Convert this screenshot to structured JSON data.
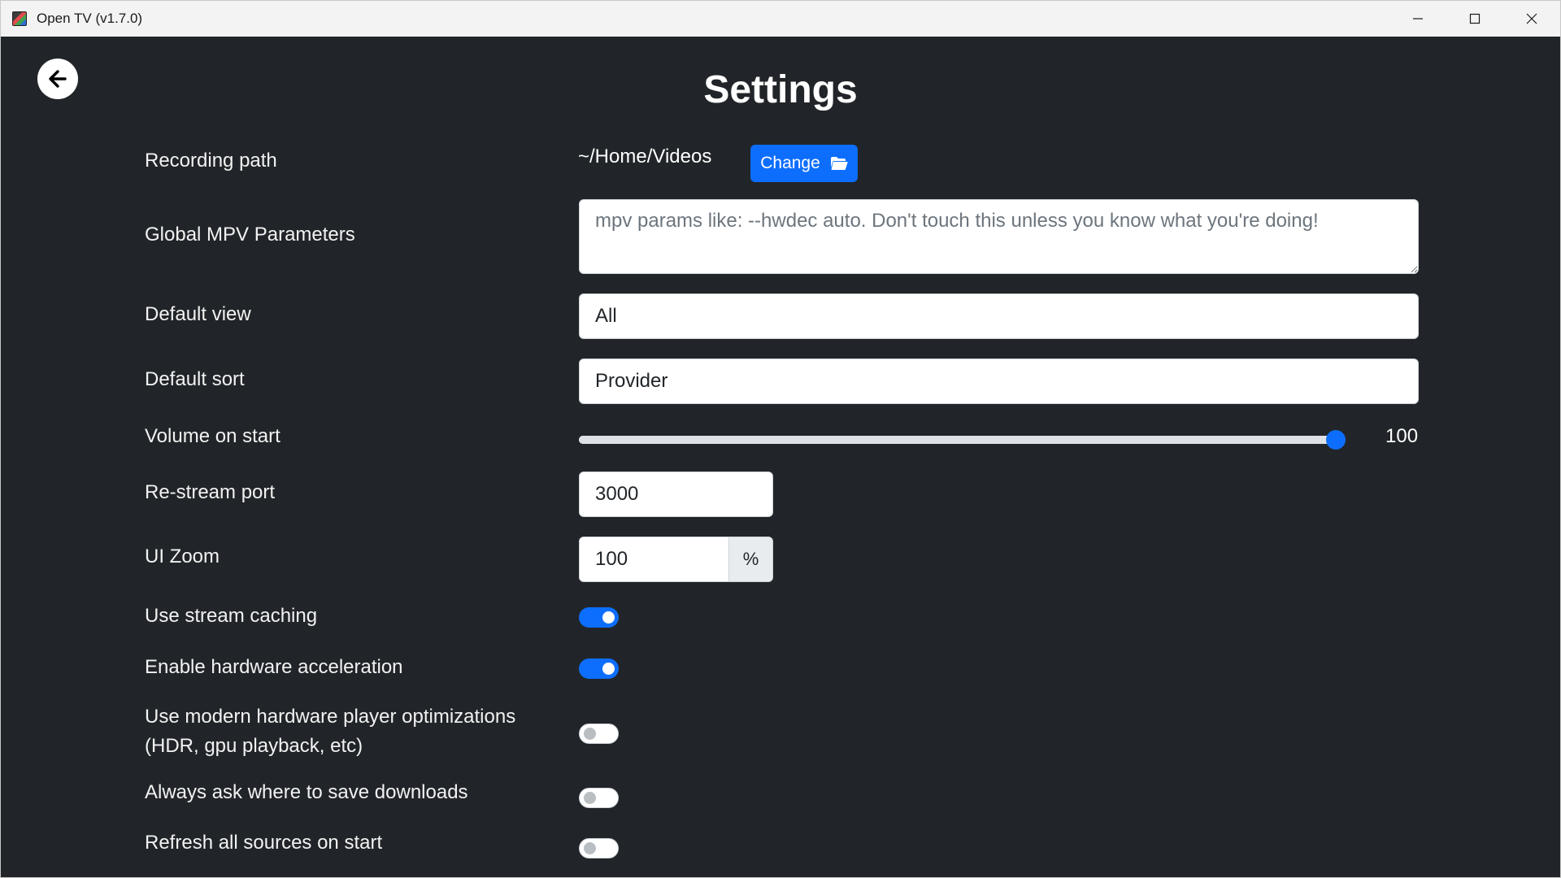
{
  "window": {
    "title": "Open TV (v1.7.0)",
    "controls": [
      "minimize-icon",
      "maximize-icon",
      "close-icon"
    ]
  },
  "page": {
    "title": "Settings",
    "back_icon": "arrow-left-icon"
  },
  "settings": {
    "recording_path": {
      "label": "Recording path",
      "value": "~/Home/Videos",
      "button_label": "Change",
      "button_icon": "folder-open-icon"
    },
    "mpv_params": {
      "label": "Global MPV Parameters",
      "value": "",
      "placeholder": "mpv params like: --hwdec auto. Don't touch this unless you know what you're doing!"
    },
    "default_view": {
      "label": "Default view",
      "value": "All"
    },
    "default_sort": {
      "label": "Default sort",
      "value": "Provider"
    },
    "volume": {
      "label": "Volume on start",
      "value": "100",
      "level_percent": 100
    },
    "restream_port": {
      "label": "Re-stream port",
      "value": "3000"
    },
    "ui_zoom": {
      "label": "UI Zoom",
      "value": "100",
      "unit": "%"
    },
    "toggles": [
      {
        "label": "Use stream caching",
        "on": true
      },
      {
        "label": "Enable hardware acceleration",
        "on": true
      },
      {
        "label_line1": "Use modern hardware player optimizations",
        "label_line2": "(HDR, gpu playback, etc)",
        "on": false
      },
      {
        "label": "Always ask where to save downloads",
        "on": false
      },
      {
        "label": "Refresh all sources on start",
        "on": false
      }
    ]
  },
  "colors": {
    "background": "#212529",
    "accent": "#0d6efd",
    "titlebar": "#f3f3f3"
  }
}
